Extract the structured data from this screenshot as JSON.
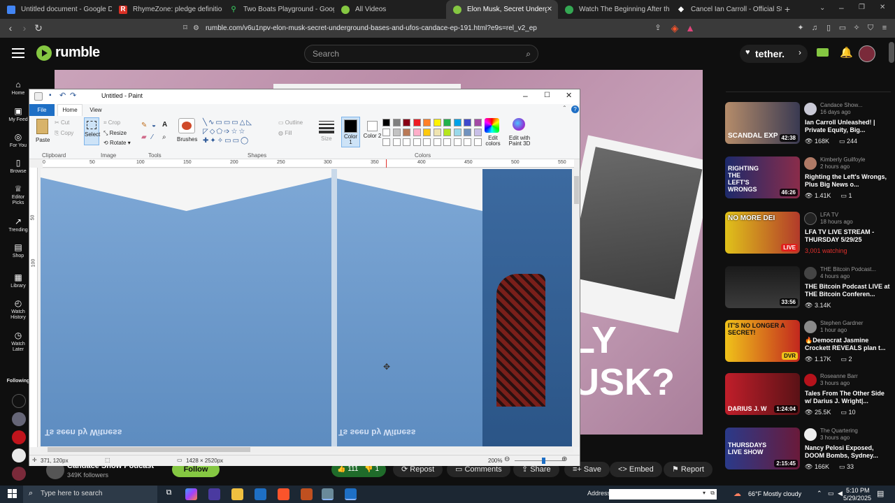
{
  "browser": {
    "tabs": [
      {
        "title": "Untitled document - Google Docs",
        "color": "#4285f4"
      },
      {
        "title": "RhymeZone: pledge definitions",
        "color": "#d93025"
      },
      {
        "title": "Two Boats Playground - Google Ma",
        "color": "#34a853"
      },
      {
        "title": "All Videos",
        "color": "#85c742"
      },
      {
        "title": "Elon Musk, Secret Undergroun",
        "color": "#85c742"
      },
      {
        "title": "Watch The Beginning After the End",
        "color": "#34a853"
      },
      {
        "title": "Cancel Ian Carroll - Official Store -",
        "color": "#ffffff"
      }
    ],
    "url": "rumble.com/v6u1npv-elon-musk-secret-underground-bases-and-ufos-candace-ep-191.html?e9s=rel_v2_ep"
  },
  "rumble": {
    "logo_text": "rumble",
    "search_placeholder": "Search",
    "tether_label": "tether.",
    "nav": [
      {
        "label": "Home",
        "icon": "home-icon"
      },
      {
        "label": "My Feed",
        "icon": "feed-icon"
      },
      {
        "label": "For You",
        "icon": "target-icon"
      },
      {
        "label": "Browse",
        "icon": "browse-icon"
      },
      {
        "label": "Editor Picks",
        "icon": "trophy-icon"
      },
      {
        "label": "Trending",
        "icon": "trending-icon"
      },
      {
        "label": "Shop",
        "icon": "bag-icon"
      },
      {
        "label": "Library",
        "icon": "library-icon"
      },
      {
        "label": "Watch History",
        "icon": "clock-icon"
      },
      {
        "label": "Watch Later",
        "icon": "clock-icon"
      },
      {
        "label": "Following",
        "icon": ""
      }
    ],
    "video_overlay_text": [
      "LY",
      "USK?"
    ],
    "channel_name": "Candace Show Podcast",
    "followers": "349K followers",
    "follow_label": "Follow",
    "likes": "111",
    "dislikes": "1",
    "actions": [
      "Repost",
      "Comments",
      "Share",
      "Save",
      "Embed",
      "Report"
    ],
    "recommended": [
      {
        "channel": "Candace Show...",
        "ago": "16 days ago",
        "title": "Ian Carroll Unleashed! | Private Equity, Big...",
        "views": "168K",
        "comments": "244",
        "duration": "42:38",
        "thumb_text": "SCANDAL EXP",
        "live": false,
        "watching": ""
      },
      {
        "channel": "Kimberly Guilfoyle",
        "ago": "2 hours ago",
        "title": "Righting the Left's Wrongs, Plus Big News o...",
        "views": "1.41K",
        "comments": "1",
        "duration": "46:26",
        "thumb_text": "RIGHTING THE LEFT'S WRONGS",
        "live": false,
        "watching": ""
      },
      {
        "channel": "LFA TV",
        "ago": "18 hours ago",
        "title": "LFA TV LIVE STREAM - THURSDAY 5/29/25",
        "views": "",
        "comments": "",
        "duration": "LIVE",
        "thumb_text": "NO MORE DEI",
        "live": true,
        "watching": "3,001 watching"
      },
      {
        "channel": "THE Bitcoin Podcast...",
        "ago": "4 hours ago",
        "title": "THE Bitcoin Podcast LIVE at THE Bitcoin Conferen...",
        "views": "3.14K",
        "comments": "",
        "duration": "33:56",
        "thumb_text": "",
        "live": false,
        "watching": ""
      },
      {
        "channel": "Stephen Gardner",
        "ago": "1 hour ago",
        "title": "🔥Democrat Jasmine Crockett REVEALS plan t...",
        "views": "1.17K",
        "comments": "2",
        "duration": "DVR",
        "thumb_text": "IT'S NO LONGER A SECRET!",
        "live": false,
        "watching": ""
      },
      {
        "channel": "Roseanne Barr",
        "ago": "3 hours ago",
        "title": "Tales From The Other Side w/ Darius J. Wright|...",
        "views": "25.5K",
        "comments": "10",
        "duration": "1:24:04",
        "thumb_text": "DARIUS J. W",
        "live": false,
        "watching": ""
      },
      {
        "channel": "The Quartering",
        "ago": "3 hours ago",
        "title": "Nancy Pelosi Exposed, DOOM Bombs, Sydney...",
        "views": "166K",
        "comments": "33",
        "duration": "2:15:45",
        "thumb_text": "THURSDAYS LIVE SHOW",
        "live": false,
        "watching": ""
      }
    ]
  },
  "paint": {
    "title": "Untitled - Paint",
    "tabs": [
      "File",
      "Home",
      "View"
    ],
    "clipboard": {
      "paste": "Paste",
      "cut": "Cut",
      "copy": "Copy",
      "group": "Clipboard"
    },
    "image": {
      "select": "Select",
      "crop": "Crop",
      "resize": "Resize",
      "rotate": "Rotate",
      "group": "Image"
    },
    "tools_group": "Tools",
    "brushes": "Brushes",
    "shapes_group": "Shapes",
    "outline": "Outline",
    "fill": "Fill",
    "size": "Size",
    "color1": "Color 1",
    "color2": "Color 2",
    "colors_group": "Colors",
    "edit_colors": "Edit colors",
    "edit_paint3d": "Edit with Paint 3D",
    "ruler_marks": [
      "0",
      "50",
      "100",
      "150",
      "200",
      "250",
      "300",
      "350",
      "400",
      "450",
      "500",
      "550"
    ],
    "vruler_marks": [
      "50",
      "100"
    ],
    "palette": [
      "#000000",
      "#7f7f7f",
      "#880015",
      "#ed1c24",
      "#ff7f27",
      "#fff200",
      "#22b14c",
      "#00a2e8",
      "#3f48cc",
      "#a349a4",
      "#ffffff",
      "#c3c3c3",
      "#b97a57",
      "#ffaec9",
      "#ffc90e",
      "#efe4b0",
      "#b5e61d",
      "#99d9ea",
      "#7092be",
      "#c8bfe7"
    ],
    "cursor_pos": "371, 120px",
    "image_size": "1428 × 2520px",
    "zoom": "200%",
    "zoom_fraction": 0.55,
    "canvas_caption": "Ts seen by Witness"
  },
  "taskbar": {
    "search_placeholder": "Type here to search",
    "address_label": "Address",
    "weather": "66°F  Mostly cloudy",
    "time": "5:10 PM",
    "date": "5/29/2025"
  }
}
